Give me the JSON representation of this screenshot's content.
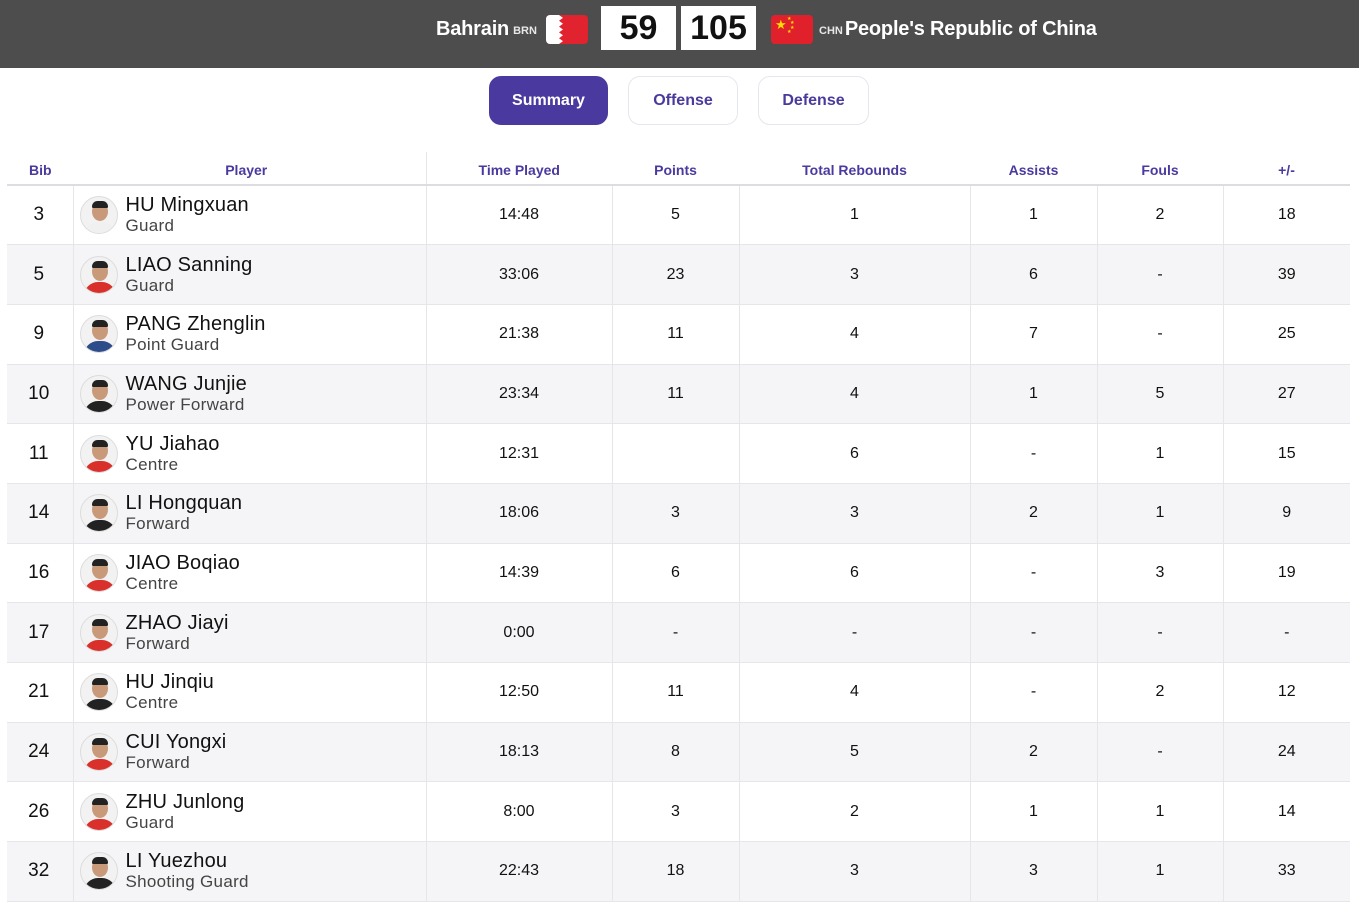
{
  "scoreboard": {
    "home": {
      "name": "Bahrain",
      "code": "BRN",
      "score": "59",
      "flag_icon": "bahrain-flag-icon"
    },
    "away": {
      "name": "People's Republic of China",
      "code": "CHN",
      "score": "105",
      "flag_icon": "china-flag-icon"
    }
  },
  "tabs": [
    {
      "label": "Summary",
      "active": true
    },
    {
      "label": "Offense",
      "active": false
    },
    {
      "label": "Defense",
      "active": false
    }
  ],
  "table": {
    "columns": [
      "Bib",
      "Player",
      "Time Played",
      "Points",
      "Total Rebounds",
      "Assists",
      "Fouls",
      "+/-"
    ],
    "rows": [
      {
        "bib": "3",
        "name": "HU Mingxuan",
        "position": "Guard",
        "time": "14:48",
        "points": "5",
        "rebounds": "1",
        "assists": "1",
        "fouls": "2",
        "plus_minus": "18"
      },
      {
        "bib": "5",
        "name": "LIAO Sanning",
        "position": "Guard",
        "time": "33:06",
        "points": "23",
        "rebounds": "3",
        "assists": "6",
        "fouls": "-",
        "plus_minus": "39"
      },
      {
        "bib": "9",
        "name": "PANG Zhenglin",
        "position": "Point Guard",
        "time": "21:38",
        "points": "11",
        "rebounds": "4",
        "assists": "7",
        "fouls": "-",
        "plus_minus": "25"
      },
      {
        "bib": "10",
        "name": "WANG Junjie",
        "position": "Power Forward",
        "time": "23:34",
        "points": "11",
        "rebounds": "4",
        "assists": "1",
        "fouls": "5",
        "plus_minus": "27"
      },
      {
        "bib": "11",
        "name": "YU Jiahao",
        "position": "Centre",
        "time": "12:31",
        "points": "",
        "rebounds": "6",
        "assists": "-",
        "fouls": "1",
        "plus_minus": "15"
      },
      {
        "bib": "14",
        "name": "LI Hongquan",
        "position": "Forward",
        "time": "18:06",
        "points": "3",
        "rebounds": "3",
        "assists": "2",
        "fouls": "1",
        "plus_minus": "9"
      },
      {
        "bib": "16",
        "name": "JIAO Boqiao",
        "position": "Centre",
        "time": "14:39",
        "points": "6",
        "rebounds": "6",
        "assists": "-",
        "fouls": "3",
        "plus_minus": "19"
      },
      {
        "bib": "17",
        "name": "ZHAO Jiayi",
        "position": "Forward",
        "time": "0:00",
        "points": "-",
        "rebounds": "-",
        "assists": "-",
        "fouls": "-",
        "plus_minus": "-"
      },
      {
        "bib": "21",
        "name": "HU Jinqiu",
        "position": "Centre",
        "time": "12:50",
        "points": "11",
        "rebounds": "4",
        "assists": "-",
        "fouls": "2",
        "plus_minus": "12"
      },
      {
        "bib": "24",
        "name": "CUI Yongxi",
        "position": "Forward",
        "time": "18:13",
        "points": "8",
        "rebounds": "5",
        "assists": "2",
        "fouls": "-",
        "plus_minus": "24"
      },
      {
        "bib": "26",
        "name": "ZHU Junlong",
        "position": "Guard",
        "time": "8:00",
        "points": "3",
        "rebounds": "2",
        "assists": "1",
        "fouls": "1",
        "plus_minus": "14"
      },
      {
        "bib": "32",
        "name": "LI Yuezhou",
        "position": "Shooting Guard",
        "time": "22:43",
        "points": "18",
        "rebounds": "3",
        "assists": "3",
        "fouls": "1",
        "plus_minus": "33"
      }
    ]
  },
  "colors": {
    "accent": "#4a3a9f",
    "scorebar": "#4d4d4d"
  }
}
